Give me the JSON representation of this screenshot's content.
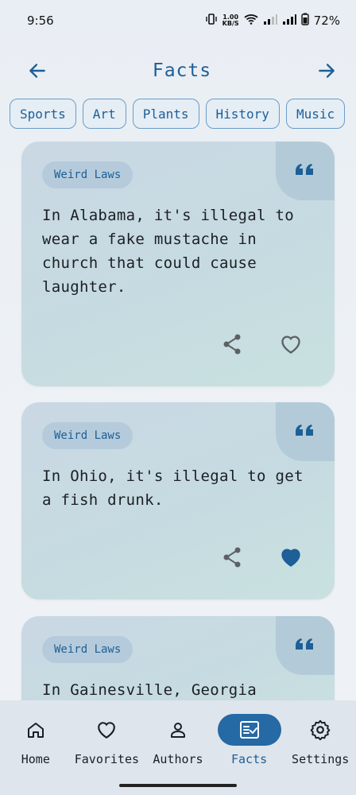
{
  "status": {
    "time": "9:56",
    "net_speed_value": "1.00",
    "net_speed_unit": "KB/S",
    "battery": "72%"
  },
  "topbar": {
    "title": "Facts",
    "back_icon": "arrow-left-icon",
    "forward_icon": "arrow-right-icon"
  },
  "categories": [
    "Sports",
    "Art",
    "Plants",
    "History",
    "Music"
  ],
  "cards": [
    {
      "tag": "Weird Laws",
      "text": "In Alabama, it's illegal to wear a fake mustache in church that could cause laughter.",
      "liked": false
    },
    {
      "tag": "Weird Laws",
      "text": "In Ohio, it's illegal to get a fish drunk.",
      "liked": true
    },
    {
      "tag": "Weird Laws",
      "text": "In Gainesville, Georgia",
      "liked": false
    }
  ],
  "nav": {
    "items": [
      {
        "label": "Home",
        "icon": "home-icon"
      },
      {
        "label": "Favorites",
        "icon": "heart-icon"
      },
      {
        "label": "Authors",
        "icon": "person-icon"
      },
      {
        "label": "Facts",
        "icon": "facts-icon",
        "active": true
      },
      {
        "label": "Settings",
        "icon": "gear-icon"
      }
    ]
  },
  "colors": {
    "accent": "#1d5f96",
    "active_nav": "#2569a5",
    "card_bg": "#c6dbe1",
    "liked_heart": "#1d5f96"
  }
}
